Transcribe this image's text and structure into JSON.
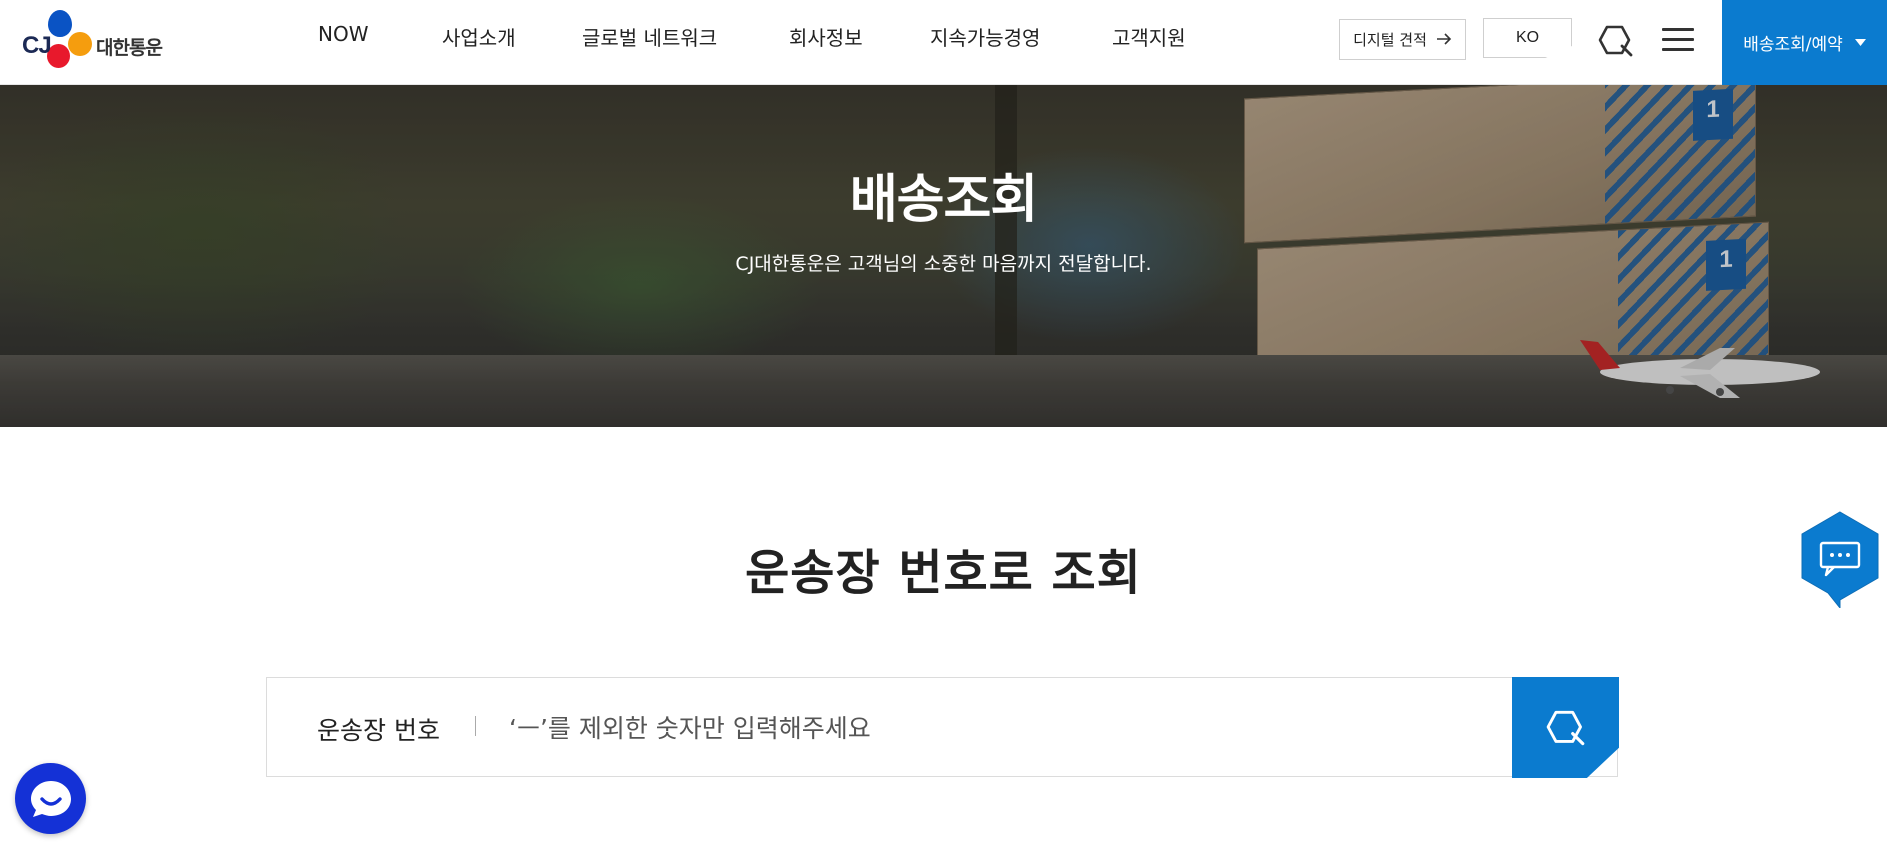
{
  "header": {
    "logo_text": "대한통운",
    "logo_mark": "CJ",
    "nav": [
      "NOW",
      "사업소개",
      "글로벌 네트워크",
      "회사정보",
      "지속가능경영",
      "고객지원"
    ],
    "quote_button": "디지털 견적",
    "lang_button": "KO",
    "track_button": "배송조회/예약",
    "icons": {
      "search": "search-icon",
      "menu": "hamburger-menu-icon",
      "arrow": "arrow-right-icon",
      "caret": "caret-down-icon"
    }
  },
  "hero": {
    "title": "배송조회",
    "subtitle": "CJ대한통운은 고객님의 소중한 마음까지 전달합니다."
  },
  "main": {
    "section_title": "운송장 번호로 조회",
    "search": {
      "label": "운송장 번호",
      "placeholder": "‘ㅡ’를 제외한 숫자만 입력해주세요",
      "value": ""
    }
  },
  "floating": {
    "chat_icon": "chat-bubble-icon",
    "bot_icon": "chatbot-icon"
  },
  "colors": {
    "brand_blue": "#0b7bcf",
    "bot_blue": "#1431d6",
    "text": "#222222"
  }
}
